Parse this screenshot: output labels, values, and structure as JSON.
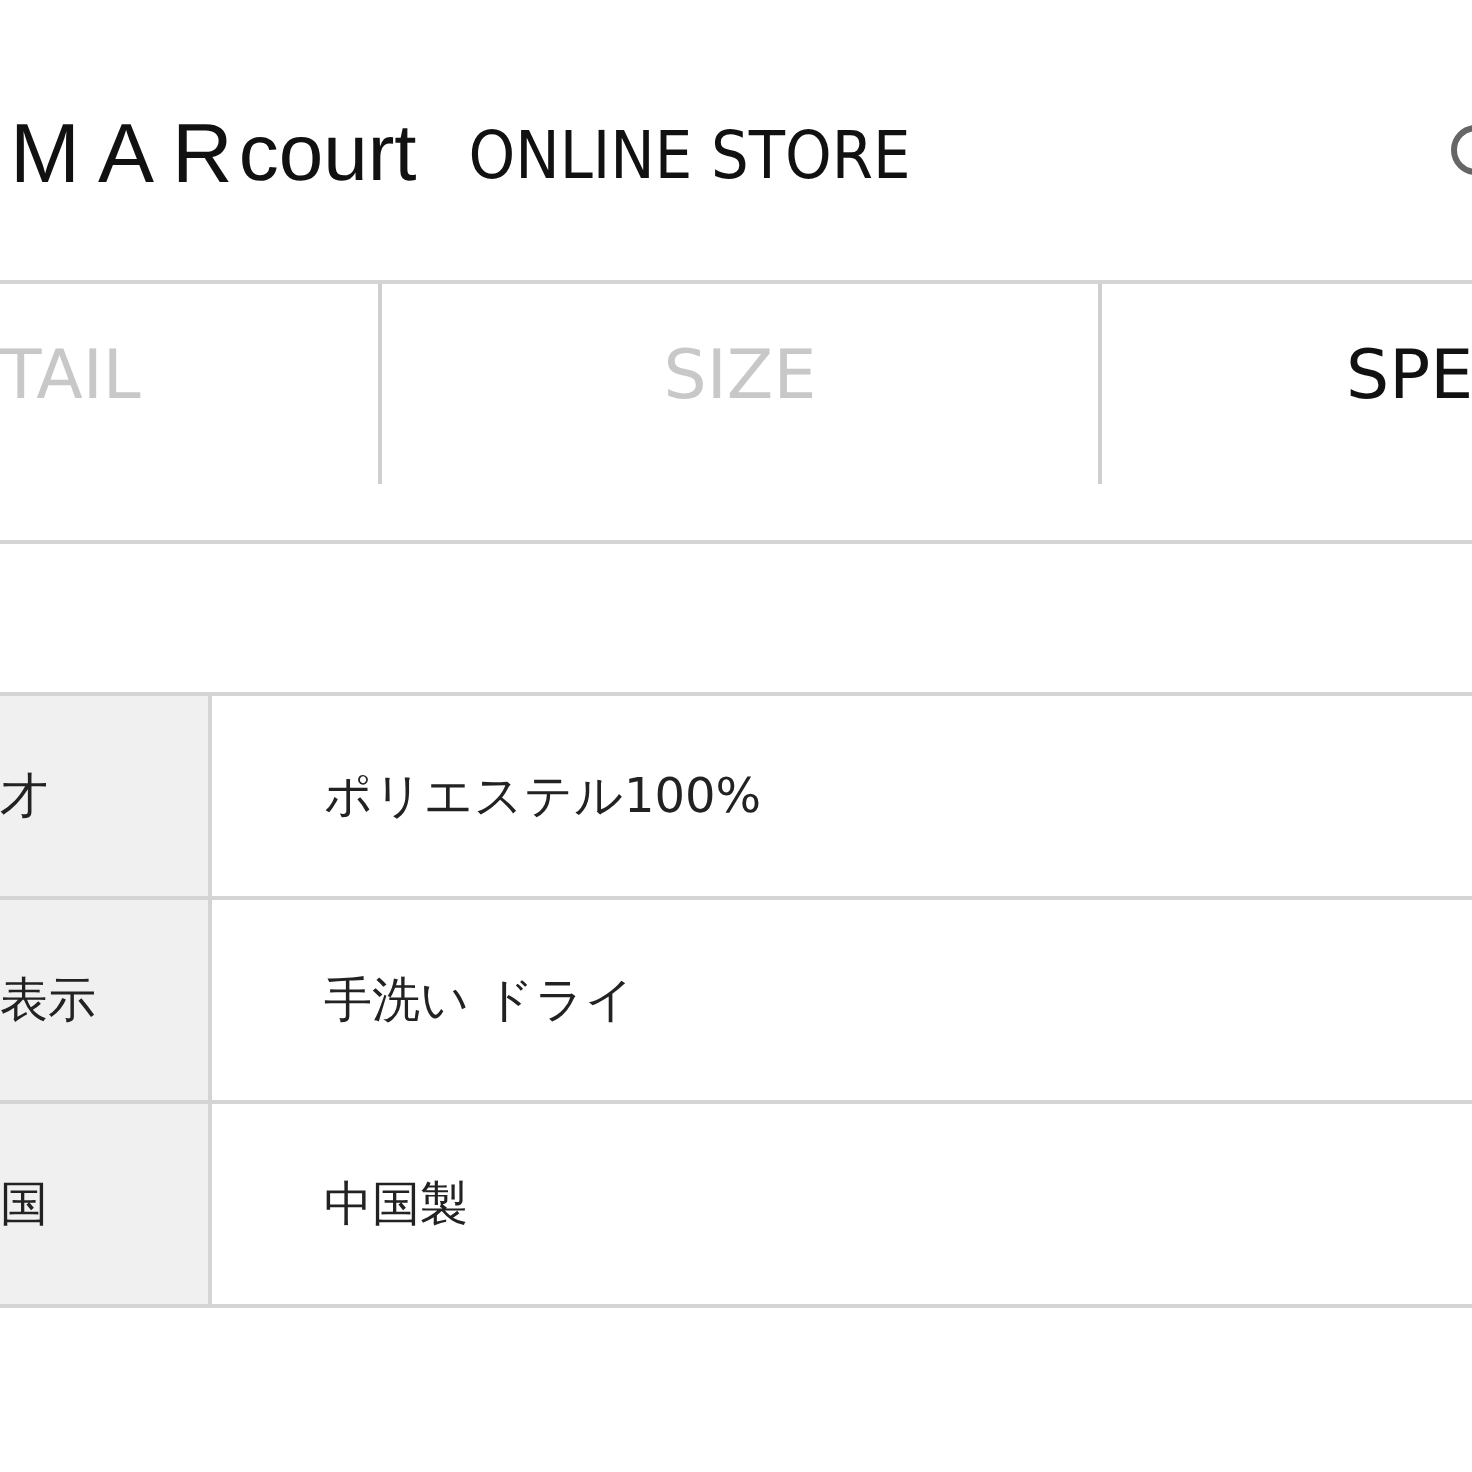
{
  "header": {
    "logo": {
      "brand": "MAR",
      "suffix": "court"
    },
    "store_name": "ONLINE STORE"
  },
  "tabs": [
    {
      "label": "TAIL",
      "selected": false
    },
    {
      "label": "SIZE",
      "selected": false
    },
    {
      "label": "SPE",
      "selected": true
    }
  ],
  "spec_table": {
    "rows": [
      {
        "label": "才",
        "value": "ポリエステル100%"
      },
      {
        "label": "表示",
        "value": "手洗い ドライ"
      },
      {
        "label": "国",
        "value": "中国製"
      }
    ]
  }
}
